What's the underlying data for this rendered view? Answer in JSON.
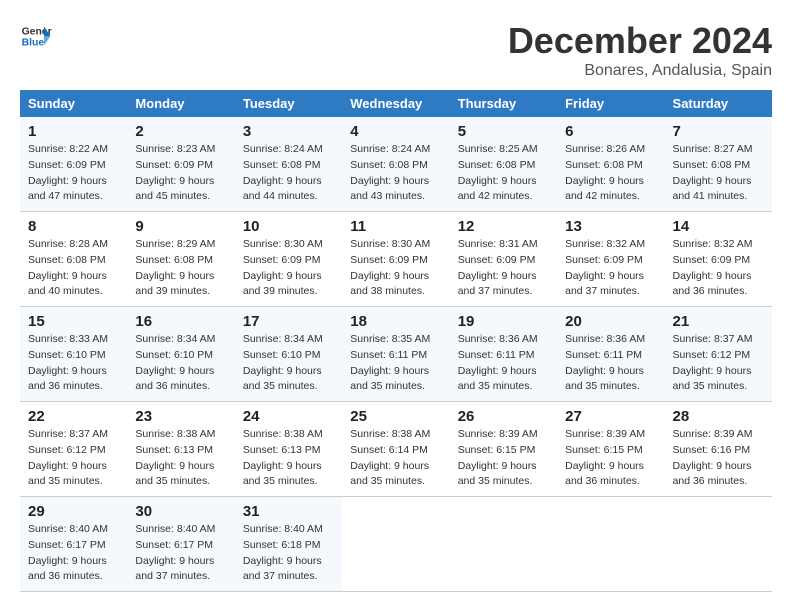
{
  "header": {
    "logo_line1": "General",
    "logo_line2": "Blue",
    "month": "December 2024",
    "location": "Bonares, Andalusia, Spain"
  },
  "weekdays": [
    "Sunday",
    "Monday",
    "Tuesday",
    "Wednesday",
    "Thursday",
    "Friday",
    "Saturday"
  ],
  "weeks": [
    [
      {
        "day": 1,
        "sunrise": "8:22 AM",
        "sunset": "6:09 PM",
        "daylight": "9 hours and 47 minutes."
      },
      {
        "day": 2,
        "sunrise": "8:23 AM",
        "sunset": "6:09 PM",
        "daylight": "9 hours and 45 minutes."
      },
      {
        "day": 3,
        "sunrise": "8:24 AM",
        "sunset": "6:08 PM",
        "daylight": "9 hours and 44 minutes."
      },
      {
        "day": 4,
        "sunrise": "8:24 AM",
        "sunset": "6:08 PM",
        "daylight": "9 hours and 43 minutes."
      },
      {
        "day": 5,
        "sunrise": "8:25 AM",
        "sunset": "6:08 PM",
        "daylight": "9 hours and 42 minutes."
      },
      {
        "day": 6,
        "sunrise": "8:26 AM",
        "sunset": "6:08 PM",
        "daylight": "9 hours and 42 minutes."
      },
      {
        "day": 7,
        "sunrise": "8:27 AM",
        "sunset": "6:08 PM",
        "daylight": "9 hours and 41 minutes."
      }
    ],
    [
      {
        "day": 8,
        "sunrise": "8:28 AM",
        "sunset": "6:08 PM",
        "daylight": "9 hours and 40 minutes."
      },
      {
        "day": 9,
        "sunrise": "8:29 AM",
        "sunset": "6:08 PM",
        "daylight": "9 hours and 39 minutes."
      },
      {
        "day": 10,
        "sunrise": "8:30 AM",
        "sunset": "6:09 PM",
        "daylight": "9 hours and 39 minutes."
      },
      {
        "day": 11,
        "sunrise": "8:30 AM",
        "sunset": "6:09 PM",
        "daylight": "9 hours and 38 minutes."
      },
      {
        "day": 12,
        "sunrise": "8:31 AM",
        "sunset": "6:09 PM",
        "daylight": "9 hours and 37 minutes."
      },
      {
        "day": 13,
        "sunrise": "8:32 AM",
        "sunset": "6:09 PM",
        "daylight": "9 hours and 37 minutes."
      },
      {
        "day": 14,
        "sunrise": "8:32 AM",
        "sunset": "6:09 PM",
        "daylight": "9 hours and 36 minutes."
      }
    ],
    [
      {
        "day": 15,
        "sunrise": "8:33 AM",
        "sunset": "6:10 PM",
        "daylight": "9 hours and 36 minutes."
      },
      {
        "day": 16,
        "sunrise": "8:34 AM",
        "sunset": "6:10 PM",
        "daylight": "9 hours and 36 minutes."
      },
      {
        "day": 17,
        "sunrise": "8:34 AM",
        "sunset": "6:10 PM",
        "daylight": "9 hours and 35 minutes."
      },
      {
        "day": 18,
        "sunrise": "8:35 AM",
        "sunset": "6:11 PM",
        "daylight": "9 hours and 35 minutes."
      },
      {
        "day": 19,
        "sunrise": "8:36 AM",
        "sunset": "6:11 PM",
        "daylight": "9 hours and 35 minutes."
      },
      {
        "day": 20,
        "sunrise": "8:36 AM",
        "sunset": "6:11 PM",
        "daylight": "9 hours and 35 minutes."
      },
      {
        "day": 21,
        "sunrise": "8:37 AM",
        "sunset": "6:12 PM",
        "daylight": "9 hours and 35 minutes."
      }
    ],
    [
      {
        "day": 22,
        "sunrise": "8:37 AM",
        "sunset": "6:12 PM",
        "daylight": "9 hours and 35 minutes."
      },
      {
        "day": 23,
        "sunrise": "8:38 AM",
        "sunset": "6:13 PM",
        "daylight": "9 hours and 35 minutes."
      },
      {
        "day": 24,
        "sunrise": "8:38 AM",
        "sunset": "6:13 PM",
        "daylight": "9 hours and 35 minutes."
      },
      {
        "day": 25,
        "sunrise": "8:38 AM",
        "sunset": "6:14 PM",
        "daylight": "9 hours and 35 minutes."
      },
      {
        "day": 26,
        "sunrise": "8:39 AM",
        "sunset": "6:15 PM",
        "daylight": "9 hours and 35 minutes."
      },
      {
        "day": 27,
        "sunrise": "8:39 AM",
        "sunset": "6:15 PM",
        "daylight": "9 hours and 36 minutes."
      },
      {
        "day": 28,
        "sunrise": "8:39 AM",
        "sunset": "6:16 PM",
        "daylight": "9 hours and 36 minutes."
      }
    ],
    [
      {
        "day": 29,
        "sunrise": "8:40 AM",
        "sunset": "6:17 PM",
        "daylight": "9 hours and 36 minutes."
      },
      {
        "day": 30,
        "sunrise": "8:40 AM",
        "sunset": "6:17 PM",
        "daylight": "9 hours and 37 minutes."
      },
      {
        "day": 31,
        "sunrise": "8:40 AM",
        "sunset": "6:18 PM",
        "daylight": "9 hours and 37 minutes."
      },
      null,
      null,
      null,
      null
    ]
  ]
}
